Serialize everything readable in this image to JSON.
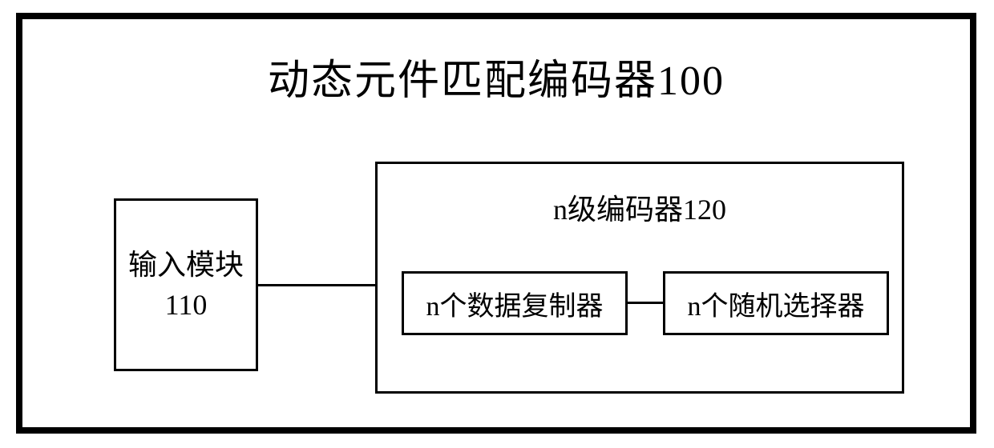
{
  "title": "动态元件匹配编码器100",
  "inputModule": {
    "line1": "输入模块",
    "line2": "110"
  },
  "encoder": {
    "title": "n级编码器120",
    "dataReplicator": "n个数据复制器",
    "randomSelector": "n个随机选择器"
  }
}
